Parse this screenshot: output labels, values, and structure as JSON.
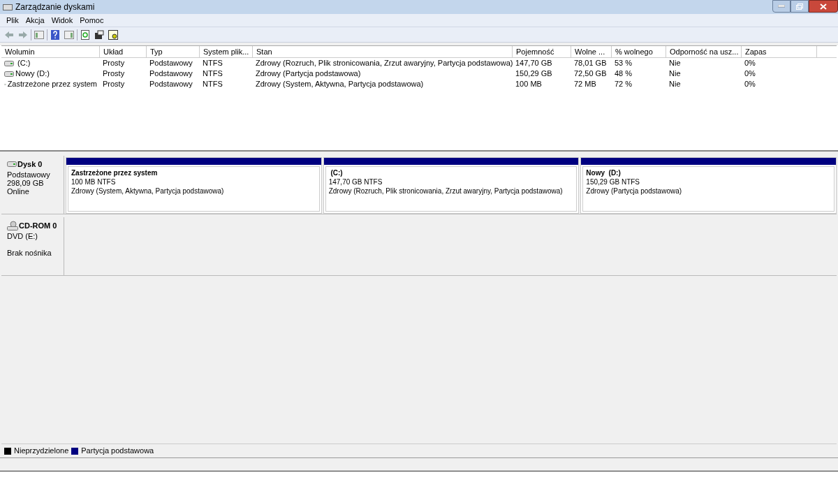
{
  "window": {
    "title": "Zarządzanie dyskami"
  },
  "menu": [
    "Plik",
    "Akcja",
    "Widok",
    "Pomoc"
  ],
  "volume_table": {
    "columns": [
      "Wolumin",
      "Układ",
      "Typ",
      "System plik...",
      "Stan",
      "Pojemność",
      "Wolne ...",
      "% wolnego",
      "Odporność na usz...",
      "Zapas"
    ],
    "rows": [
      {
        "cells": [
          " (C:)",
          "Prosty",
          "Podstawowy",
          "NTFS",
          "Zdrowy (Rozruch, Plik stronicowania, Zrzut awaryjny, Partycja podstawowa)",
          "147,70 GB",
          "78,01 GB",
          "53 %",
          "Nie",
          "0%"
        ]
      },
      {
        "cells": [
          "Nowy (D:)",
          "Prosty",
          "Podstawowy",
          "NTFS",
          "Zdrowy (Partycja podstawowa)",
          "150,29 GB",
          "72,50 GB",
          "48 %",
          "Nie",
          "0%"
        ]
      },
      {
        "cells": [
          "Zastrzeżone przez system",
          "Prosty",
          "Podstawowy",
          "NTFS",
          "Zdrowy (System, Aktywna, Partycja podstawowa)",
          "100 MB",
          "72 MB",
          "72 %",
          "Nie",
          "0%"
        ]
      }
    ]
  },
  "disks": [
    {
      "kind": "disk",
      "name": "Dysk 0",
      "lines": [
        "Podstawowy",
        "298,09 GB",
        "Online"
      ],
      "partitions": [
        {
          "name": "Zastrzeżone przez system",
          "size": "100 MB NTFS",
          "status": "Zdrowy (System, Aktywna, Partycja podstawowa)",
          "color": "#000080"
        },
        {
          "name": " (C:)",
          "size": "147,70 GB NTFS",
          "status": "Zdrowy (Rozruch, Plik stronicowania, Zrzut awaryjny, Partycja podstawowa)",
          "color": "#000080"
        },
        {
          "name": "Nowy  (D:)",
          "size": "150,29 GB NTFS",
          "status": "Zdrowy (Partycja podstawowa)",
          "color": "#000080"
        }
      ]
    },
    {
      "kind": "cdrom",
      "name": "CD-ROM 0",
      "lines": [
        "DVD (E:)",
        "Brak nośnika"
      ]
    }
  ],
  "legend": [
    {
      "label": "Nieprzydzielone",
      "color": "#000000"
    },
    {
      "label": "Partycja podstawowa",
      "color": "#000080"
    }
  ]
}
